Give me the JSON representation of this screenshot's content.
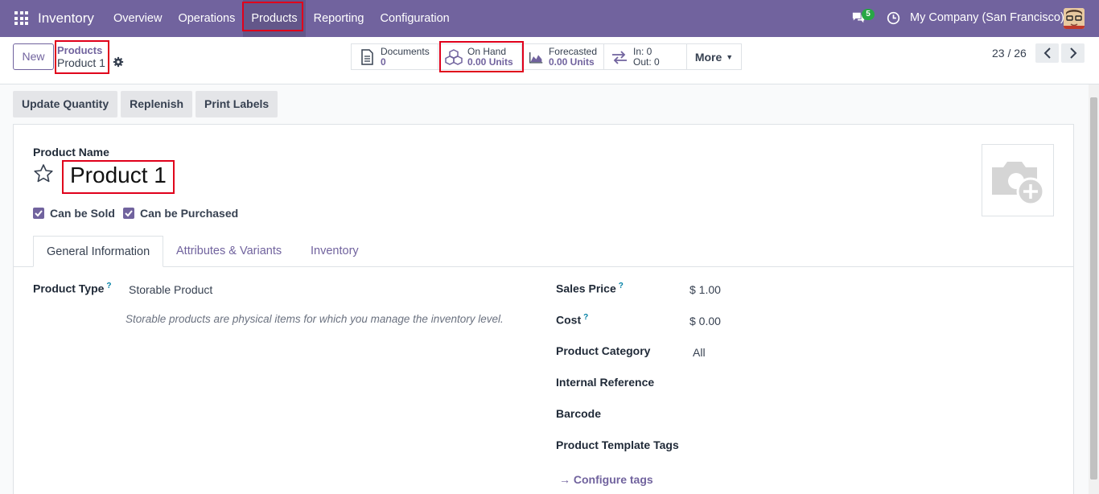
{
  "navbar": {
    "brand": "Inventory",
    "menu": [
      "Overview",
      "Operations",
      "Products",
      "Reporting",
      "Configuration"
    ],
    "active_menu": "Products",
    "messages_count": "5",
    "company": "My Company (San Francisco)"
  },
  "control": {
    "new_label": "New",
    "breadcrumb_parent": "Products",
    "breadcrumb_current": "Product 1",
    "stats": {
      "documents": {
        "label": "Documents",
        "value": "0"
      },
      "on_hand": {
        "label": "On Hand",
        "value": "0.00 Units"
      },
      "forecasted": {
        "label": "Forecasted",
        "value": "0.00 Units"
      },
      "in": "In: 0",
      "out": "Out: 0",
      "more": "More"
    },
    "pager": "23 / 26"
  },
  "actions": [
    "Update Quantity",
    "Replenish",
    "Print Labels"
  ],
  "form": {
    "product_name_label": "Product Name",
    "product_name": "Product 1",
    "can_be_sold": "Can be Sold",
    "can_be_purchased": "Can be Purchased",
    "tabs": [
      "General Information",
      "Attributes & Variants",
      "Inventory"
    ],
    "left": {
      "product_type_label": "Product Type",
      "product_type": "Storable Product",
      "product_type_hint": "Storable products are physical items for which you manage the inventory level."
    },
    "right": {
      "sales_price_label": "Sales Price",
      "sales_price": "$ 1.00",
      "cost_label": "Cost",
      "cost": "$ 0.00",
      "category_label": "Product Category",
      "category": "All",
      "internal_ref_label": "Internal Reference",
      "barcode_label": "Barcode",
      "tags_label": "Product Template Tags",
      "configure_tags": "Configure tags"
    },
    "help_mark": "?"
  },
  "colors": {
    "navbar": "#71639e",
    "accent": "#71639e",
    "highlight": "#e0001b"
  }
}
